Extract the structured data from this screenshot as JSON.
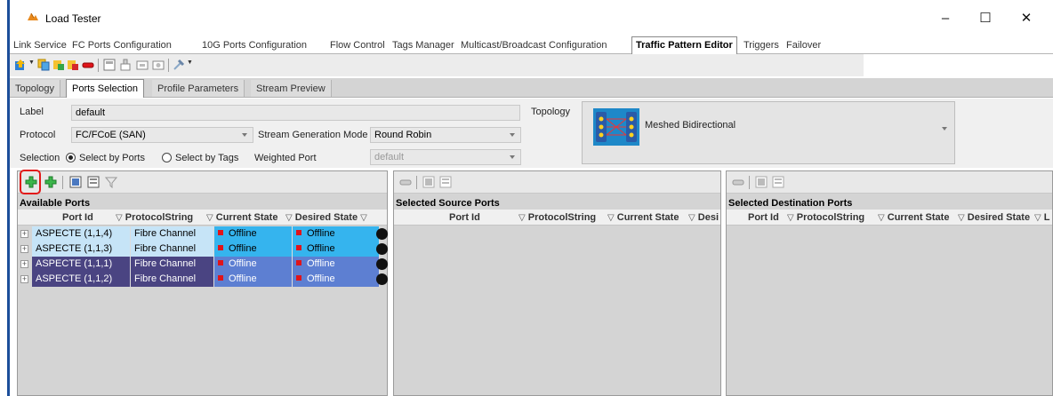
{
  "window": {
    "title": "Load Tester"
  },
  "main_tabs": [
    {
      "label": "Link Service"
    },
    {
      "label": "FC Ports Configuration"
    },
    {
      "label": "10G Ports Configuration"
    },
    {
      "label": "Flow Control"
    },
    {
      "label": "Tags Manager"
    },
    {
      "label": "Multicast/Broadcast Configuration"
    },
    {
      "label": "Traffic Pattern Editor"
    },
    {
      "label": "Triggers"
    },
    {
      "label": "Failover"
    }
  ],
  "sub_tabs": [
    {
      "label": "Topology"
    },
    {
      "label": "Ports Selection"
    },
    {
      "label": "Profile Parameters"
    },
    {
      "label": "Stream Preview"
    }
  ],
  "form": {
    "label_caption": "Label",
    "label_value": "default",
    "protocol_caption": "Protocol",
    "protocol_value": "FC/FCoE (SAN)",
    "stream_mode_caption": "Stream Generation Mode",
    "stream_mode_value": "Round Robin",
    "selection_caption": "Selection",
    "select_by_ports": "Select by Ports",
    "select_by_tags": "Select by Tags",
    "weighted_port_caption": "Weighted Port",
    "weighted_port_value": "default",
    "topology_caption": "Topology",
    "topology_value": "Meshed Bidirectional"
  },
  "available_ports": {
    "title": "Available Ports",
    "columns": [
      "Port Id",
      "ProtocolString",
      "Current State",
      "Desired State"
    ],
    "rows": [
      {
        "port_id": "ASPECTE (1,1,4)",
        "protocol": "Fibre Channel",
        "current": "Offline",
        "desired": "Offline"
      },
      {
        "port_id": "ASPECTE (1,1,3)",
        "protocol": "Fibre Channel",
        "current": "Offline",
        "desired": "Offline"
      },
      {
        "port_id": "ASPECTE (1,1,1)",
        "protocol": "Fibre Channel",
        "current": "Offline",
        "desired": "Offline"
      },
      {
        "port_id": "ASPECTE (1,1,2)",
        "protocol": "Fibre Channel",
        "current": "Offline",
        "desired": "Offline"
      }
    ]
  },
  "source_ports": {
    "title": "Selected Source Ports",
    "columns": [
      "Port Id",
      "ProtocolString",
      "Current State",
      "Desi"
    ]
  },
  "dest_ports": {
    "title": "Selected Destination Ports",
    "columns": [
      "Port Id",
      "ProtocolString",
      "Current State",
      "Desired State",
      "L"
    ]
  },
  "colors": {
    "row_light": "#c6e4f7",
    "row_selected": "#4a4482",
    "state_light": "#35b4ee",
    "state_selected": "#5d7fd2",
    "offline_marker": "#e0141a"
  }
}
